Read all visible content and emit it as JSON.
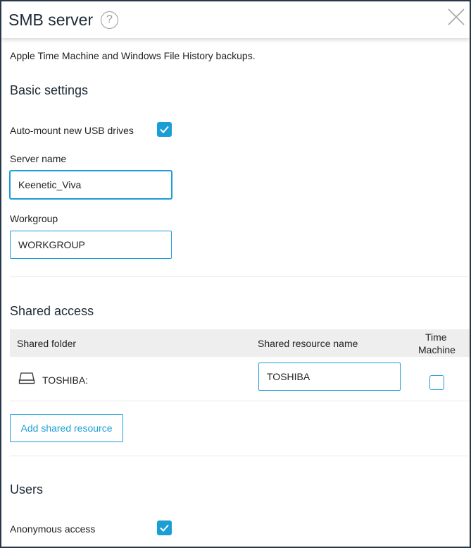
{
  "dialog": {
    "title": "SMB server",
    "help_glyph": "?",
    "description": "Apple Time Machine and Windows File History backups."
  },
  "basic_settings": {
    "heading": "Basic settings",
    "automount_label": "Auto-mount new USB drives",
    "automount_checked": true,
    "server_name_label": "Server name",
    "server_name_value": "Keenetic_Viva",
    "workgroup_label": "Workgroup",
    "workgroup_value": "WORKGROUP"
  },
  "shared_access": {
    "heading": "Shared access",
    "columns": [
      "Shared folder",
      "Shared resource name",
      "Time",
      "Machine"
    ],
    "rows": [
      {
        "folder": "TOSHIBA:",
        "resource_name": "TOSHIBA",
        "time_machine": false
      }
    ],
    "add_button": "Add shared resource"
  },
  "users": {
    "heading": "Users",
    "anonymous_label": "Anonymous access",
    "anonymous_checked": true
  },
  "colors": {
    "accent": "#1b9ed6",
    "frame": "#263849",
    "table_header": "#eeeeee"
  }
}
